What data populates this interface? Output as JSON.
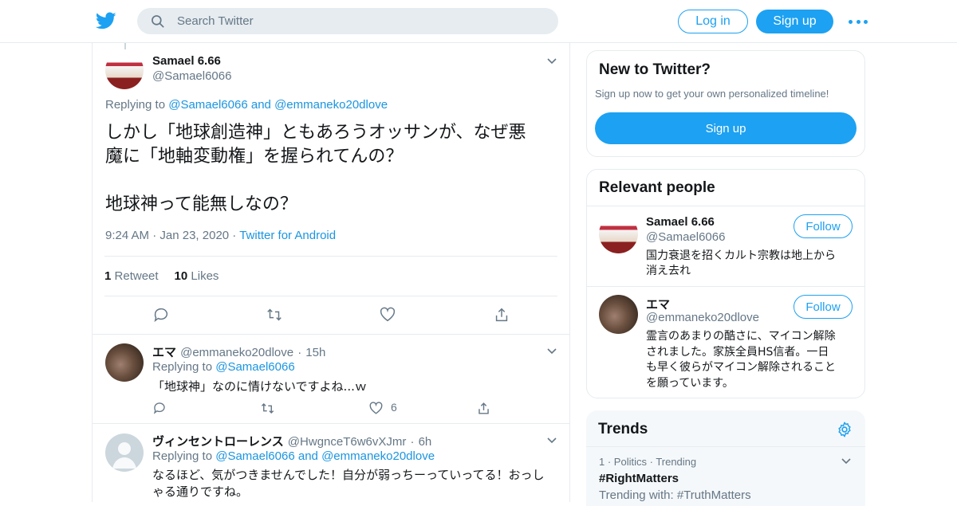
{
  "header": {
    "search_placeholder": "Search Twitter",
    "login_label": "Log in",
    "signup_label": "Sign up"
  },
  "tweet": {
    "author_name": "Samael 6.66",
    "author_handle": "@Samael6066",
    "replying_prefix": "Replying to",
    "replying_to_1": "@Samael6066",
    "replying_and": "and",
    "replying_to_2": "@emmaneko20dlove",
    "text_line1": "しかし「地球創造神」ともあろうオッサンが、なぜ悪",
    "text_line2": "魔に「地軸変動権」を握られてんの？",
    "text_line3": "地球神って能無しなの？",
    "time": "9:24 AM",
    "date": "Jan 23, 2020",
    "source": "Twitter for Android",
    "retweets_count": "1",
    "retweets_label": "Retweet",
    "likes_count": "10",
    "likes_label": "Likes"
  },
  "replies": [
    {
      "name": "エマ",
      "handle": "@emmaneko20dlove",
      "age": "15h",
      "replying_prefix": "Replying to",
      "replying_to_1": "@Samael6066",
      "text_line1": "「地球神」なのに情けないですよね...ｗ",
      "likes": "6"
    },
    {
      "name": "ヴィンセントローレンス",
      "handle": "@HwgnceT6w6vXJmr",
      "age": "6h",
      "replying_prefix": "Replying to",
      "replying_to_1": "@Samael6066",
      "replying_and": "and",
      "replying_to_2": "@emmaneko20dlove",
      "text_line1": "なるほど、気がつきませんでした！自分が弱っちーっていってる！おっし",
      "text_line2": "ゃる通りですね。"
    }
  ],
  "new_to_twitter": {
    "title": "New to Twitter?",
    "subtitle": "Sign up now to get your own personalized timeline!",
    "button": "Sign up"
  },
  "relevant_people": {
    "title": "Relevant people",
    "people": [
      {
        "name": "Samael 6.66",
        "handle": "@Samael6066",
        "follow": "Follow",
        "bio_line1": "国力衰退を招くカルト宗教は地上から",
        "bio_line2": "消え去れ"
      },
      {
        "name": "エマ",
        "handle": "@emmaneko20dlove",
        "follow": "Follow",
        "bio_line1": "霊言のあまりの酷さに、マイコン解除",
        "bio_line2": "されました。家族全員HS信者。一日",
        "bio_line3": "も早く彼らがマイコン解除されること",
        "bio_line4": "を願っています。"
      }
    ]
  },
  "trends": {
    "title": "Trends",
    "items": [
      {
        "rank": "1",
        "category": "Politics",
        "status": "Trending",
        "name": "#RightMatters",
        "with_label": "Trending with:",
        "with_tag": "#TruthMatters"
      }
    ]
  },
  "colors": {
    "brand": "#1da1f2",
    "link": "#1b95e0",
    "muted": "#657786",
    "border": "#e6ecf0"
  },
  "icons": [
    "twitter-bird-icon",
    "search-icon",
    "more-icon",
    "chevron-down-icon",
    "reply-icon",
    "retweet-icon",
    "like-icon",
    "share-icon",
    "gear-icon"
  ]
}
